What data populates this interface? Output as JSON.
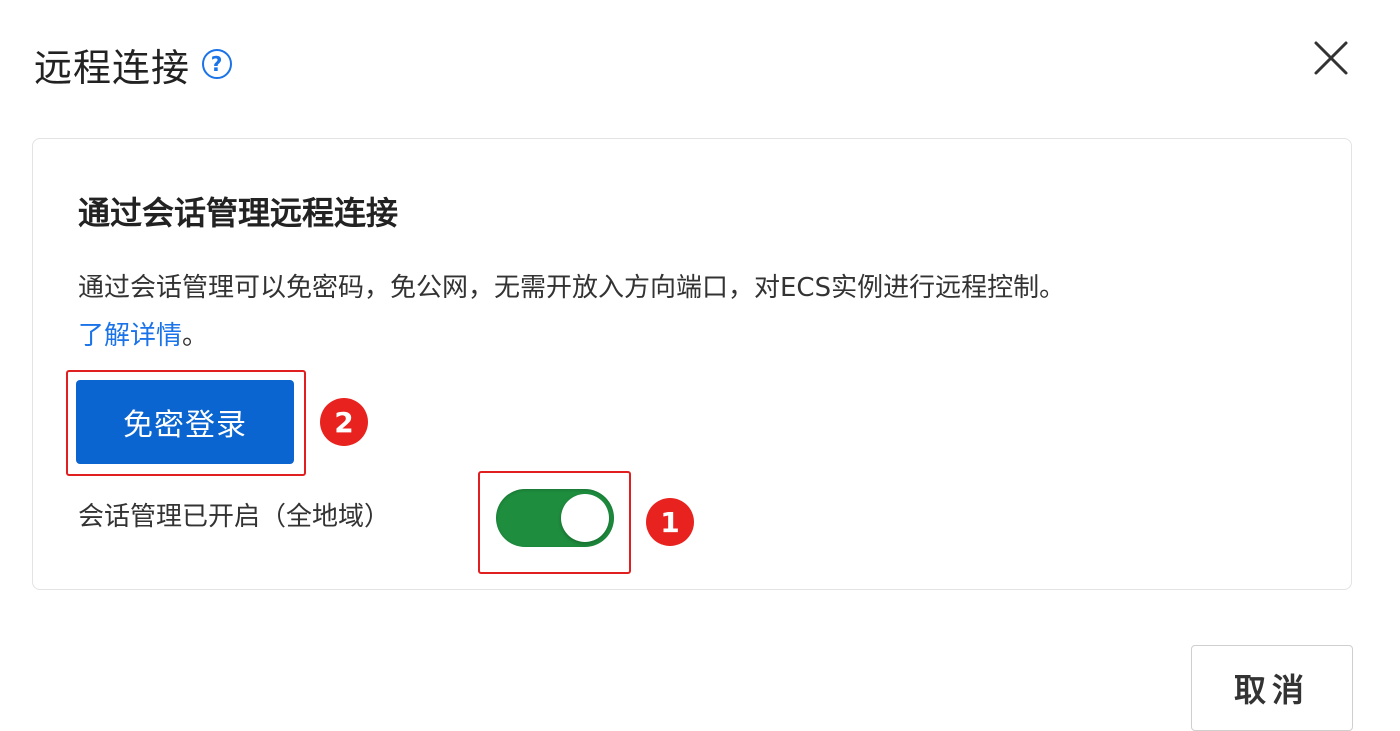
{
  "dialog": {
    "title": "远程连接",
    "help_icon": "question-circle-icon",
    "close_icon": "close-icon"
  },
  "card": {
    "title": "通过会话管理远程连接",
    "description": "通过会话管理可以免密码，免公网，无需开放入方向端口，对ECS实例进行远程控制。",
    "learn_more": "了解详情",
    "learn_more_suffix": "。",
    "login_button": "免密登录",
    "session_label": "会话管理已开启（全地域）",
    "session_enabled": true
  },
  "annotations": {
    "badge_1": "1",
    "badge_2": "2"
  },
  "footer": {
    "cancel_button": "取消"
  },
  "colors": {
    "primary": "#0b65d0",
    "link": "#1a73e8",
    "toggle_on": "#1e8e3e",
    "annotation_red": "#e02020"
  }
}
